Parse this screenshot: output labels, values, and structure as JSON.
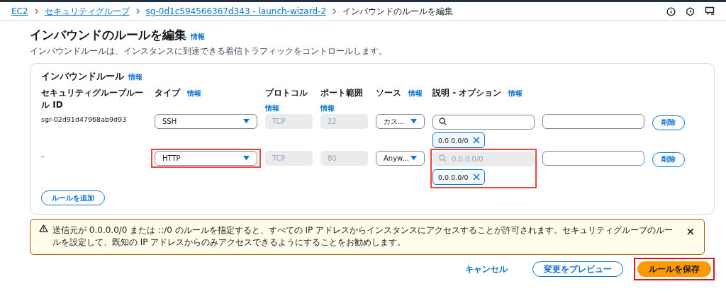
{
  "breadcrumbs": [
    {
      "label": "EC2",
      "kind": "link"
    },
    {
      "label": "セキュリティグループ",
      "kind": "link"
    },
    {
      "label": "sg-0d1c594566367d343 - launch-wizard-2",
      "kind": "link"
    },
    {
      "label": "インバウンドのルールを編集",
      "kind": "current"
    }
  ],
  "page": {
    "title": "インバウンドのルールを編集",
    "info_link": "情報",
    "description": "インバウンドルールは、インスタンスに到達できる着信トラフィックをコントロールします。"
  },
  "rules_panel": {
    "title": "インバウンドルール",
    "info_link": "情報",
    "columns": [
      {
        "label": "セキュリティグループルール ID"
      },
      {
        "label": "タイプ",
        "info": "情報"
      },
      {
        "label": "プロトコル",
        "info": "情報"
      },
      {
        "label": "ポート範囲",
        "info": "情報"
      },
      {
        "label": "ソース",
        "info": "情報"
      },
      {
        "label": "説明 - オプション",
        "info": "情報"
      }
    ],
    "rows": [
      {
        "rule_id": "sgr-02d91d47968ab9d93",
        "type": "SSH",
        "type_highlighted": false,
        "protocol": "TCP",
        "port": "22",
        "source": "カス...",
        "search": {
          "disabled": false
        },
        "source_highlighted": false,
        "chips": [
          {
            "label": "0.0.0.0/0"
          }
        ],
        "delete": "削除"
      },
      {
        "rule_id": "–",
        "type": "HTTP",
        "type_highlighted": true,
        "protocol": "TCP",
        "port": "80",
        "source": "Anyw...",
        "search": {
          "placeholder": "0.0.0.0/0",
          "disabled": true
        },
        "source_highlighted": true,
        "chips": [
          {
            "label": "0.0.0.0/0"
          }
        ],
        "delete": "削除"
      }
    ],
    "add_button": "ルールを追加"
  },
  "warning": {
    "text": "送信元が 0.0.0.0/0 または ::/0 のルールを指定すると、すべての IP アドレスからインスタンスにアクセスすることが許可されます。セキュリティグループのルールを設定して、既知の IP アドレスからのみアクセスできるようにすることをお勧めします。"
  },
  "footer": [
    {
      "label": "キャンセル",
      "kind": "link",
      "highlighted": false
    },
    {
      "label": "変更をプレビュー",
      "kind": "secondary",
      "highlighted": false
    },
    {
      "label": "ルールを保存",
      "kind": "primary",
      "highlighted": true
    }
  ]
}
